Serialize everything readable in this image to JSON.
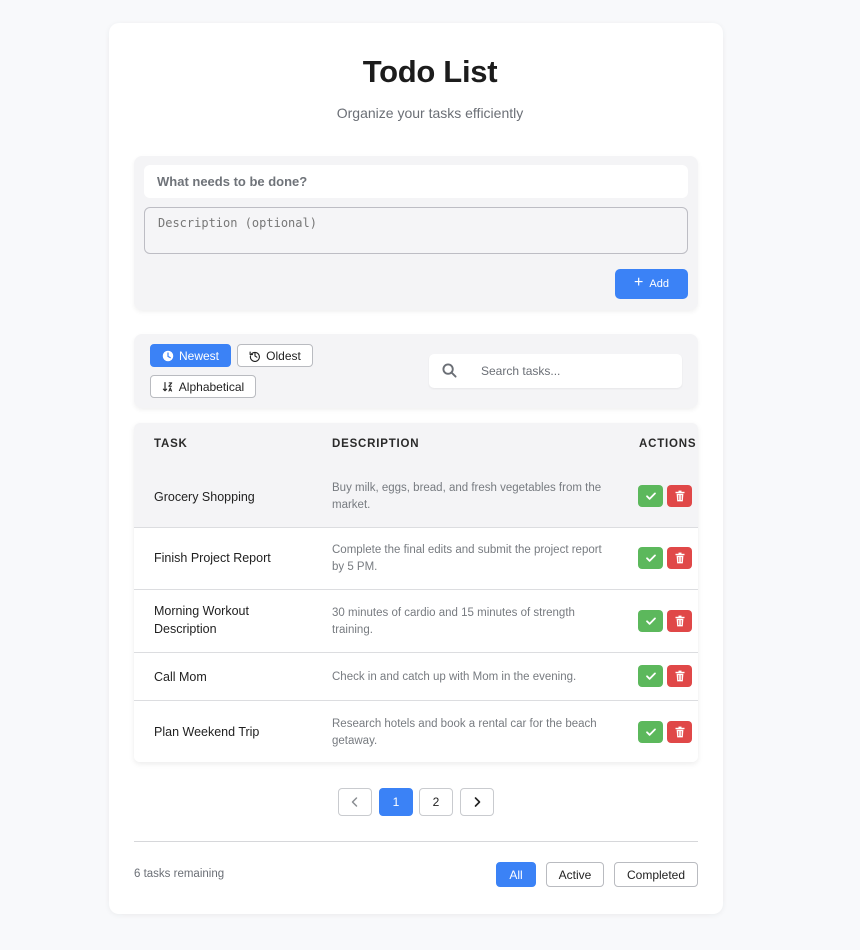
{
  "header": {
    "title": "Todo List",
    "subtitle": "Organize your tasks efficiently"
  },
  "add_form": {
    "title_placeholder": "What needs to be done?",
    "description_placeholder": "Description (optional)",
    "add_label": "Add",
    "add_icon": "plus-icon"
  },
  "sort": {
    "options": [
      {
        "label": "Newest",
        "icon": "clock-icon",
        "active": true
      },
      {
        "label": "Oldest",
        "icon": "history-icon",
        "active": false
      },
      {
        "label": "Alphabetical",
        "icon": "sort-alpha-icon",
        "active": false
      }
    ]
  },
  "search": {
    "placeholder": "Search tasks...",
    "icon": "search-icon"
  },
  "table": {
    "headers": {
      "task": "TASK",
      "description": "DESCRIPTION",
      "actions": "ACTIONS"
    },
    "rows": [
      {
        "task": "Grocery Shopping",
        "description": "Buy milk, eggs, bread, and fresh vegetables from the market."
      },
      {
        "task": "Finish Project Report",
        "description": "Complete the final edits and submit the project report by 5 PM."
      },
      {
        "task": "Morning Workout Description",
        "description": "30 minutes of cardio and 15 minutes of strength training."
      },
      {
        "task": "Call Mom",
        "description": "Check in and catch up with Mom in the evening."
      },
      {
        "task": "Plan Weekend Trip",
        "description": "Research hotels and book a rental car for the beach getaway."
      }
    ]
  },
  "pagination": {
    "pages": [
      "1",
      "2"
    ],
    "current": "1"
  },
  "footer": {
    "remaining": "6 tasks remaining",
    "filters": {
      "all": "All",
      "active": "Active",
      "completed": "Completed"
    },
    "current_filter": "All"
  },
  "colors": {
    "accent": "#3b82f6",
    "complete": "#5cb85c",
    "delete": "#e04848"
  }
}
